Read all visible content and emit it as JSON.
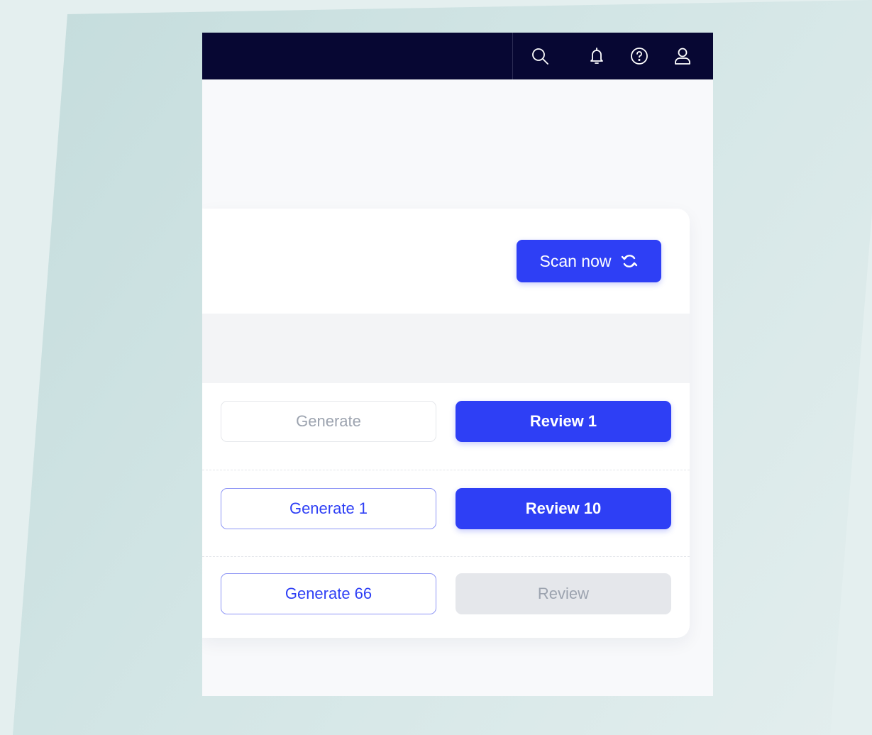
{
  "topbar": {
    "icons": [
      "search-icon",
      "bell-icon",
      "help-icon",
      "user-icon"
    ]
  },
  "scan": {
    "label": "Scan now",
    "icon": "refresh-icon"
  },
  "rows": [
    {
      "generate_label": "Generate",
      "generate_state": "disabled",
      "review_label": "Review 1",
      "review_state": "active"
    },
    {
      "generate_label": "Generate 1",
      "generate_state": "active",
      "review_label": "Review 10",
      "review_state": "active"
    },
    {
      "generate_label": "Generate 66",
      "generate_state": "active",
      "review_label": "Review",
      "review_state": "disabled"
    }
  ],
  "colors": {
    "accent": "#2e3ff5",
    "topbar": "#070733",
    "disabled_text": "#9ca3af"
  }
}
